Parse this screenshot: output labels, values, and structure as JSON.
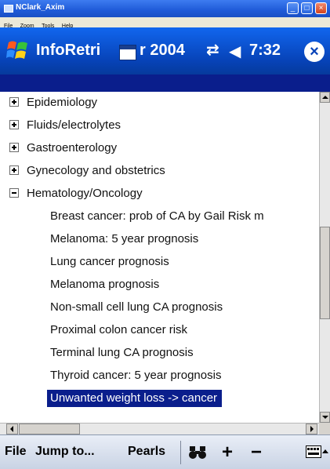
{
  "window": {
    "title": "NClark_Axim",
    "menu": [
      "File",
      "Zoom",
      "Tools",
      "Help"
    ]
  },
  "nav_bar": {
    "app_title": "InfoRetri",
    "date_text": "r 2004",
    "time": "7:32",
    "icons": [
      "start-flag-icon",
      "calendar-icon",
      "connectivity-icon",
      "volume-icon",
      "close-icon"
    ],
    "colors": {
      "bar": "#0743b8",
      "strip": "#0a1e8c",
      "selection": "#0a1e8c"
    }
  },
  "tree": {
    "parents": [
      {
        "label": "Epidemiology",
        "expanded": false
      },
      {
        "label": "Fluids/electrolytes",
        "expanded": false
      },
      {
        "label": "Gastroenterology",
        "expanded": false
      },
      {
        "label": "Gynecology and obstetrics",
        "expanded": false
      },
      {
        "label": "Hematology/Oncology",
        "expanded": true
      }
    ],
    "children": [
      "Breast cancer: prob of CA by Gail Risk m",
      "Melanoma: 5 year prognosis",
      "Lung cancer prognosis",
      "Melanoma prognosis",
      "Non-small cell lung CA prognosis",
      "Proximal colon cancer risk",
      "Terminal lung CA prognosis",
      "Thyroid cancer: 5 year prognosis",
      "Unwanted weight loss -> cancer"
    ],
    "selected_child": "Unwanted weight loss -> cancer"
  },
  "command_bar": {
    "menus": [
      "File",
      "Jump to...",
      "Pearls"
    ],
    "plus": "+",
    "minus": "−",
    "icons": [
      "binoculars-icon",
      "keyboard-icon",
      "input-selector-arrow-icon"
    ]
  }
}
